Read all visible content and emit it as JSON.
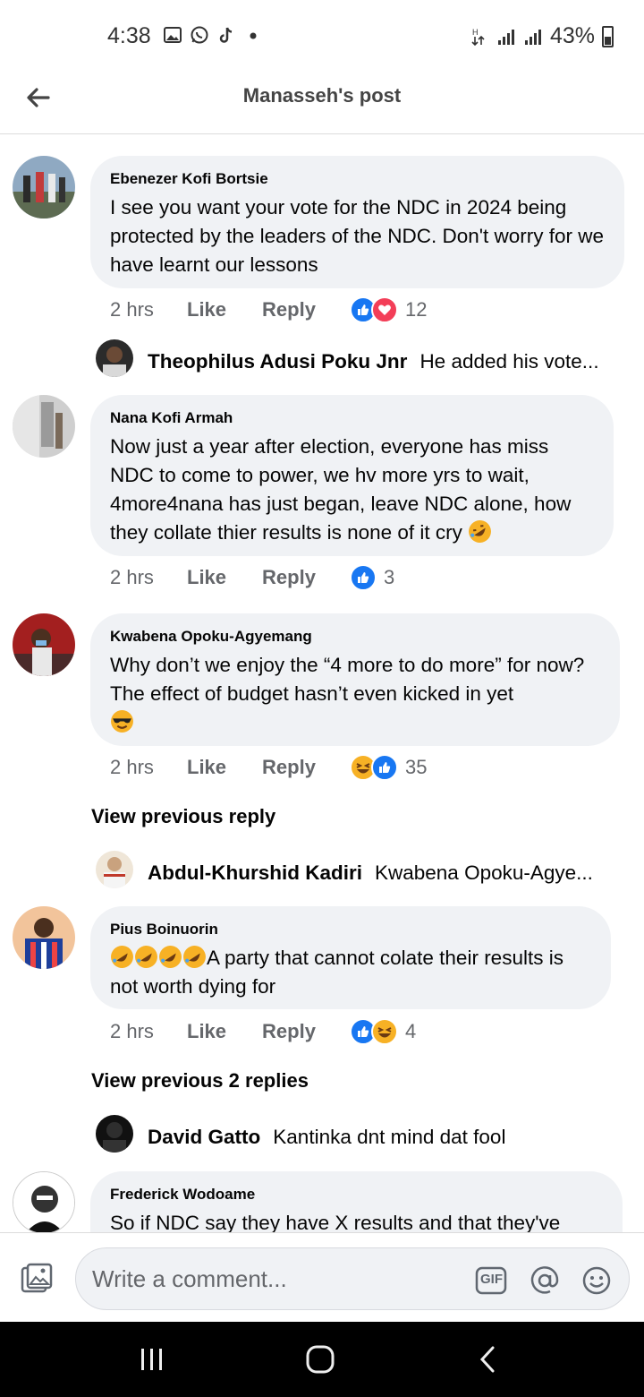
{
  "status_bar": {
    "time": "4:38",
    "battery": "43%",
    "icons": [
      "gallery-icon",
      "whatsapp-icon",
      "tiktok-icon",
      "dot-icon",
      "data-arrows-icon",
      "signal-icon",
      "signal-icon",
      "battery-icon"
    ]
  },
  "header": {
    "title": "Manasseh's post"
  },
  "comments": [
    {
      "author": "Ebenezer Kofi Bortsie",
      "text": "I see you want your vote for the NDC in 2024 being protected by the leaders of the NDC. Don't worry for we have learnt our lessons",
      "time": "2 hrs",
      "like": "Like",
      "reply": "Reply",
      "reactions": [
        "like",
        "love"
      ],
      "reaction_count": "12",
      "reply_preview": {
        "author": "Theophilus Adusi Poku Jnr",
        "text": "He added his vote..."
      }
    },
    {
      "author": "Nana Kofi Armah",
      "text": "Now just a year after election, everyone has miss NDC to come to power, we hv more yrs to wait, 4more4nana has just began, leave NDC alone, how they collate thier results is none of it cry",
      "time": "2 hrs",
      "like": "Like",
      "reply": "Reply",
      "reactions": [
        "like"
      ],
      "reaction_count": "3"
    },
    {
      "author": "Kwabena Opoku-Agyemang",
      "text": "Why don’t we enjoy the “4 more to do more” for now? The effect of budget hasn’t even kicked in yet",
      "time": "2 hrs",
      "like": "Like",
      "reply": "Reply",
      "reactions": [
        "haha",
        "like"
      ],
      "reaction_count": "35",
      "view_previous": "View previous reply",
      "reply_preview": {
        "author": "Abdul-Khurshid Kadiri",
        "text": "Kwabena Opoku-Agye..."
      }
    },
    {
      "author": "Pius Boinuorin",
      "text": "A party that cannot colate their results is not worth dying for",
      "time": "2 hrs",
      "like": "Like",
      "reply": "Reply",
      "reactions": [
        "like",
        "haha"
      ],
      "reaction_count": "4",
      "view_previous": "View previous 2 replies",
      "reply_preview": {
        "author": "David Gatto",
        "text": "Kantinka dnt mind dat fool"
      }
    },
    {
      "author": "Frederick Wodoame",
      "text": "So if NDC say they have X results and that they've"
    }
  ],
  "composer": {
    "placeholder": "Write a comment...",
    "gif_label": "GIF"
  },
  "colors": {
    "accent": "#1877f2",
    "bubble": "#f0f2f5",
    "secondary_text": "#65676b"
  }
}
